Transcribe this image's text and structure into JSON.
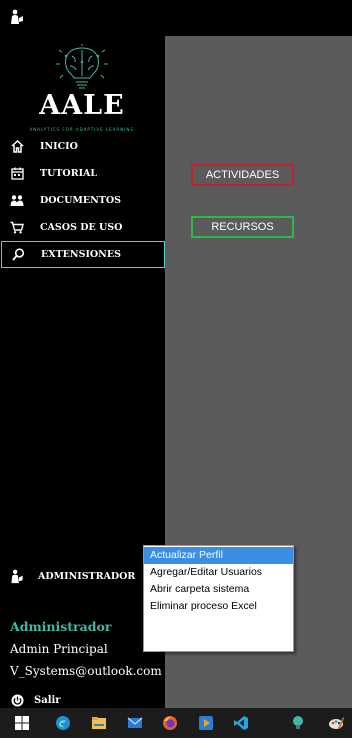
{
  "app": {
    "logo_title": "AALE",
    "logo_subtitle": "ANALYTICS FOR ADAPTIVE LEARNING"
  },
  "sidebar": {
    "items": [
      {
        "label": "INICIO",
        "icon": "home-icon"
      },
      {
        "label": "TUTORIAL",
        "icon": "calendar-icon"
      },
      {
        "label": "DOCUMENTOS",
        "icon": "people-icon"
      },
      {
        "label": "CASOS DE USO",
        "icon": "cart-icon"
      },
      {
        "label": "EXTENSIONES",
        "icon": "search-icon",
        "active": true
      }
    ],
    "admin_label": "ADMINISTRADOR",
    "admin_arrow": ">",
    "user_role": "Administrador",
    "user_name": "Admin Principal",
    "user_email": "V_Systems@outlook.com",
    "logout_label": "Salir"
  },
  "main": {
    "activities_label": "ACTIVIDADES",
    "resources_label": "RECURSOS"
  },
  "admin_menu": {
    "items": [
      "Actualizar Perfil",
      "Agregar/Editar Usuarios",
      "Abrir carpeta sistema",
      "Eliminar proceso Excel"
    ]
  },
  "taskbar": {
    "icons": [
      "windows-start-icon",
      "edge-browser-icon",
      "file-explorer-icon",
      "mail-icon",
      "firefox-icon",
      "media-player-icon",
      "vscode-icon",
      "aale-app-icon",
      "paint-icon"
    ]
  },
  "colors": {
    "accent": "#3fb9a8",
    "activities_border": "#c0242b",
    "resources_border": "#2fb84a",
    "main_bg": "#5b5b5b",
    "menu_highlight": "#3a8ee6"
  }
}
